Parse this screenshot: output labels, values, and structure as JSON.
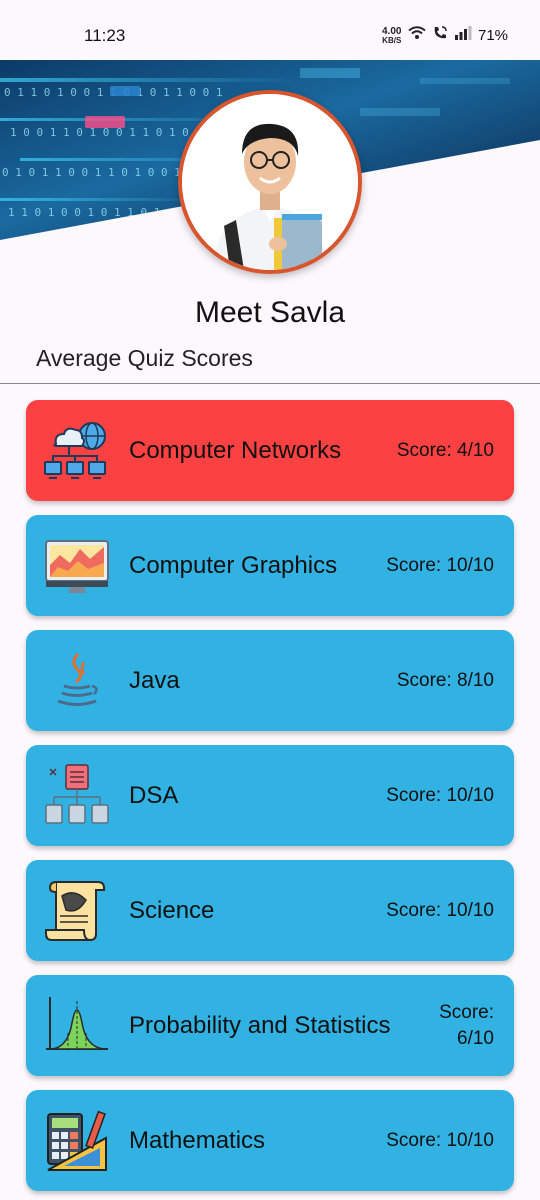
{
  "status_bar": {
    "time": "11:23",
    "speed_value": "4.00",
    "speed_unit": "KB/S",
    "battery": "71%"
  },
  "profile": {
    "name": "Meet Savla"
  },
  "section_title": "Average Quiz Scores",
  "colors": {
    "card_default": "#32b1e3",
    "card_low_score": "#fb4142",
    "avatar_ring": "#d9552e"
  },
  "quizzes": [
    {
      "subject": "Computer Networks",
      "score": "Score: 4/10",
      "icon": "computer-network-icon",
      "status": "low"
    },
    {
      "subject": "Computer Graphics",
      "score": "Score: 10/10",
      "icon": "computer-graphics-icon",
      "status": "normal"
    },
    {
      "subject": "Java",
      "score": "Score: 8/10",
      "icon": "java-icon",
      "status": "normal"
    },
    {
      "subject": "DSA",
      "score": "Score: 10/10",
      "icon": "dsa-icon",
      "status": "normal"
    },
    {
      "subject": "Science",
      "score": "Score: 10/10",
      "icon": "science-scroll-icon",
      "status": "normal"
    },
    {
      "subject": "Probability and Statistics",
      "score": "Score: 6/10",
      "icon": "probability-chart-icon",
      "status": "normal"
    },
    {
      "subject": "Mathematics",
      "score": "Score: 10/10",
      "icon": "calculator-icon",
      "status": "normal"
    }
  ]
}
